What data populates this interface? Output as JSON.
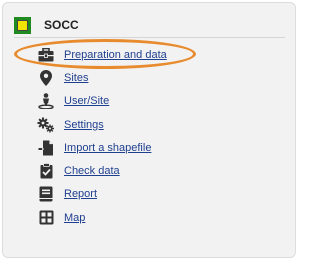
{
  "app": {
    "title": "SOCC",
    "logo_icon": "socc-logo-icon",
    "colors": {
      "logo_outer": "#1f8a1f",
      "logo_inner": "#f2e400",
      "link": "#1f3f8f",
      "highlight": "#e88b2e"
    }
  },
  "menu": {
    "items": [
      {
        "label": "Preparation and data",
        "icon": "toolbox-icon",
        "highlighted": true
      },
      {
        "label": "Sites",
        "icon": "map-marker-icon"
      },
      {
        "label": "User/Site",
        "icon": "user-location-icon"
      },
      {
        "label": "Settings",
        "icon": "gears-icon"
      },
      {
        "label": "Import a shapefile",
        "icon": "file-import-icon"
      },
      {
        "label": "Check data",
        "icon": "clipboard-check-icon"
      },
      {
        "label": "Report",
        "icon": "report-icon"
      },
      {
        "label": "Map",
        "icon": "map-grid-icon"
      }
    ]
  }
}
